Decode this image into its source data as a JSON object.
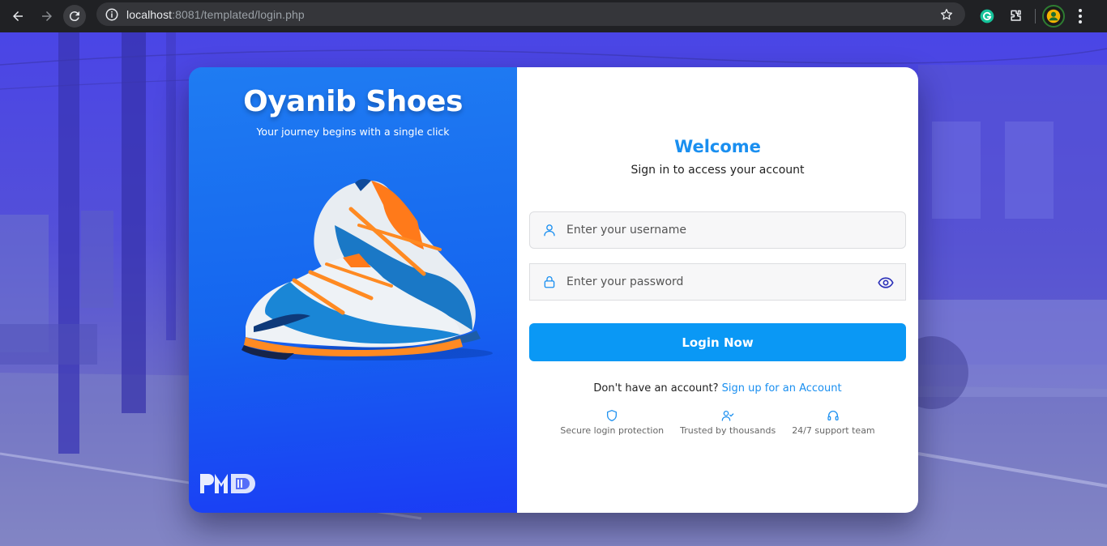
{
  "browser": {
    "url_host": "localhost",
    "url_rest": ":8081/templated/login.php",
    "icons": [
      "back-arrow-icon",
      "forward-arrow-icon",
      "reload-icon",
      "site-info-icon",
      "bookmark-star-icon",
      "grammarly-extension-icon",
      "extensions-puzzle-icon",
      "profile-avatar-icon",
      "chrome-menu-icon"
    ]
  },
  "promo": {
    "brand": "Oyanib Shoes",
    "tagline": "Your journey begins with a single click",
    "logo_text": "PMD"
  },
  "login": {
    "welcome": "Welcome",
    "subtitle": "Sign in to access your account",
    "username_placeholder": "Enter your username",
    "password_placeholder": "Enter your password",
    "login_button": "Login Now",
    "signup_prompt": "Don't have an account?",
    "signup_link": "Sign up for an Account"
  },
  "features": [
    {
      "icon": "shield-icon",
      "label": "Secure login protection"
    },
    {
      "icon": "user-check-icon",
      "label": "Trusted by thousands"
    },
    {
      "icon": "headset-icon",
      "label": "24/7 support team"
    }
  ],
  "colors": {
    "accent": "#0a98f5",
    "heading": "#1a8ff0",
    "promo_top": "#1f7cf2",
    "promo_bottom": "#1b3cf5",
    "page_bg": "#4a45e6"
  }
}
